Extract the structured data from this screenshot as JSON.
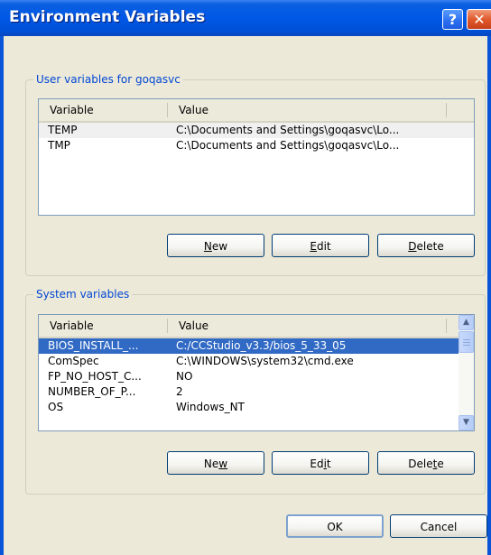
{
  "window": {
    "title": "Environment Variables",
    "help_glyph": "?",
    "close_glyph": "✕"
  },
  "user_group": {
    "label": "User variables for goqasvc",
    "columns": [
      "Variable",
      "Value"
    ],
    "rows": [
      {
        "variable": "TEMP",
        "value": "C:\\Documents and Settings\\goqasvc\\Lo..."
      },
      {
        "variable": "TMP",
        "value": "C:\\Documents and Settings\\goqasvc\\Lo..."
      }
    ],
    "buttons": {
      "new": {
        "pre": "",
        "key": "N",
        "post": "ew"
      },
      "edit": {
        "pre": "",
        "key": "E",
        "post": "dit"
      },
      "delete": {
        "pre": "",
        "key": "D",
        "post": "elete"
      }
    }
  },
  "system_group": {
    "label": "System variables",
    "columns": [
      "Variable",
      "Value"
    ],
    "rows": [
      {
        "variable": "BIOS_INSTALL_...",
        "value": "C:/CCStudio_v3.3/bios_5_33_05"
      },
      {
        "variable": "ComSpec",
        "value": "C:\\WINDOWS\\system32\\cmd.exe"
      },
      {
        "variable": "FP_NO_HOST_C...",
        "value": "NO"
      },
      {
        "variable": "NUMBER_OF_P...",
        "value": "2"
      },
      {
        "variable": "OS",
        "value": "Windows_NT"
      }
    ],
    "buttons": {
      "new": {
        "pre": "Ne",
        "key": "w",
        "post": ""
      },
      "edit": {
        "pre": "Ed",
        "key": "i",
        "post": "t"
      },
      "delete": {
        "pre": "Dele",
        "key": "t",
        "post": "e"
      }
    }
  },
  "dialog_buttons": {
    "ok": "OK",
    "cancel": "Cancel"
  },
  "colors": {
    "titlebar": "#0058e6",
    "selection": "#316ac5",
    "group_label": "#0046d5"
  }
}
